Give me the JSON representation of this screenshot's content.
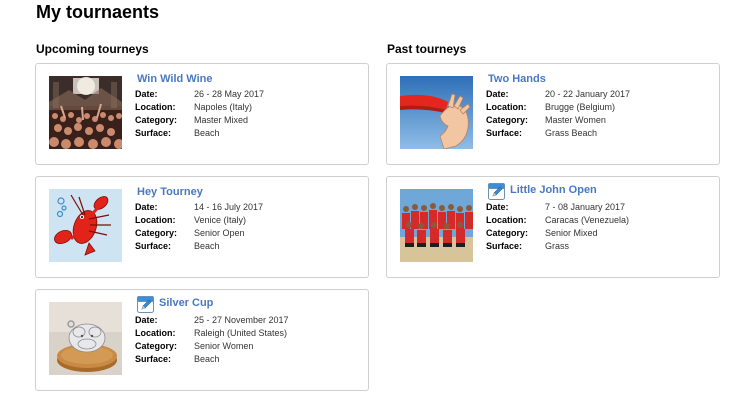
{
  "page_title": "My tournaents",
  "upcoming": {
    "heading": "Upcoming tourneys",
    "cards": [
      {
        "title": "Win Wild Wine",
        "thumb": "concert-crowd-photo",
        "has_edit_icon": false,
        "date_label": "Date:",
        "date": "26 - 28 May 2017",
        "location_label": "Location:",
        "location": "Napoles (Italy)",
        "category_label": "Category:",
        "category": "Master Mixed",
        "surface_label": "Surface:",
        "surface": "Beach"
      },
      {
        "title": "Hey Tourney",
        "thumb": "lobster-cartoon",
        "has_edit_icon": false,
        "date_label": "Date:",
        "date": "14 - 16 July 2017",
        "location_label": "Location:",
        "location": "Venice (Italy)",
        "category_label": "Category:",
        "category": "Senior Open",
        "surface_label": "Surface:",
        "surface": "Beach"
      },
      {
        "title": "Silver Cup",
        "thumb": "silver-charm-on-coin-photo",
        "has_edit_icon": true,
        "date_label": "Date:",
        "date": "25 - 27 November 2017",
        "location_label": "Location:",
        "location": "Raleigh (United States)",
        "category_label": "Category:",
        "category": "Senior Women",
        "surface_label": "Surface:",
        "surface": "Beach"
      }
    ]
  },
  "past": {
    "heading": "Past tourneys",
    "cards": [
      {
        "title": "Two Hands",
        "thumb": "hand-catching-frisbee-photo",
        "has_edit_icon": false,
        "date_label": "Date:",
        "date": "20 - 22 January 2017",
        "location_label": "Location:",
        "location": "Brugge (Belgium)",
        "category_label": "Category:",
        "category": "Master Women",
        "surface_label": "Surface:",
        "surface": "Grass Beach"
      },
      {
        "title": "Little John Open",
        "thumb": "team-group-photo",
        "has_edit_icon": true,
        "date_label": "Date:",
        "date": "7 - 08 January 2017",
        "location_label": "Location:",
        "location": "Caracas (Venezuela)",
        "category_label": "Category:",
        "category": "Senior Mixed",
        "surface_label": "Surface:",
        "surface": "Grass"
      }
    ]
  },
  "colors": {
    "title_link": "#4a78c2",
    "card_border": "#cfcfcf",
    "edit_icon": "#3a8fd8"
  }
}
